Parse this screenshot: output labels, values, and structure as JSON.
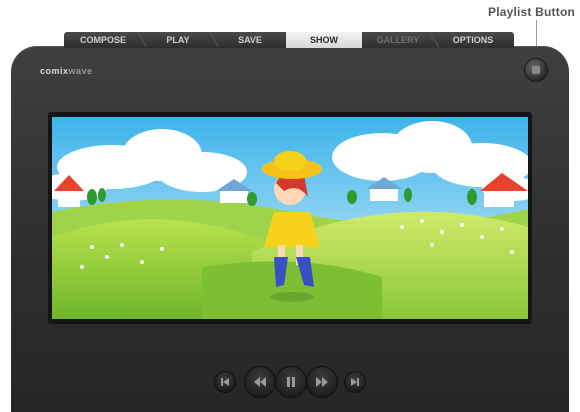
{
  "callout": {
    "playlist_label": "Playlist Button"
  },
  "tabs": [
    {
      "label": "COMPOSE",
      "state": "normal"
    },
    {
      "label": "PLAY",
      "state": "normal"
    },
    {
      "label": "SAVE",
      "state": "normal"
    },
    {
      "label": "SHOW",
      "state": "active"
    },
    {
      "label": "GALLERY",
      "state": "disabled"
    },
    {
      "label": "OPTIONS",
      "state": "normal"
    }
  ],
  "brand": {
    "logo_text": "comix",
    "logo_suffix": "wave"
  },
  "icons": {
    "playlist": "playlist-icon",
    "controls": [
      "skip-back-icon",
      "rewind-icon",
      "pause-icon",
      "fast-forward-icon",
      "skip-forward-icon"
    ]
  },
  "colors": {
    "device_body": "#333333",
    "tab_active": "#e6e6e6",
    "accent": "#a89a78",
    "sky": "#5ec4ee",
    "grass": "#8ccf3a"
  }
}
